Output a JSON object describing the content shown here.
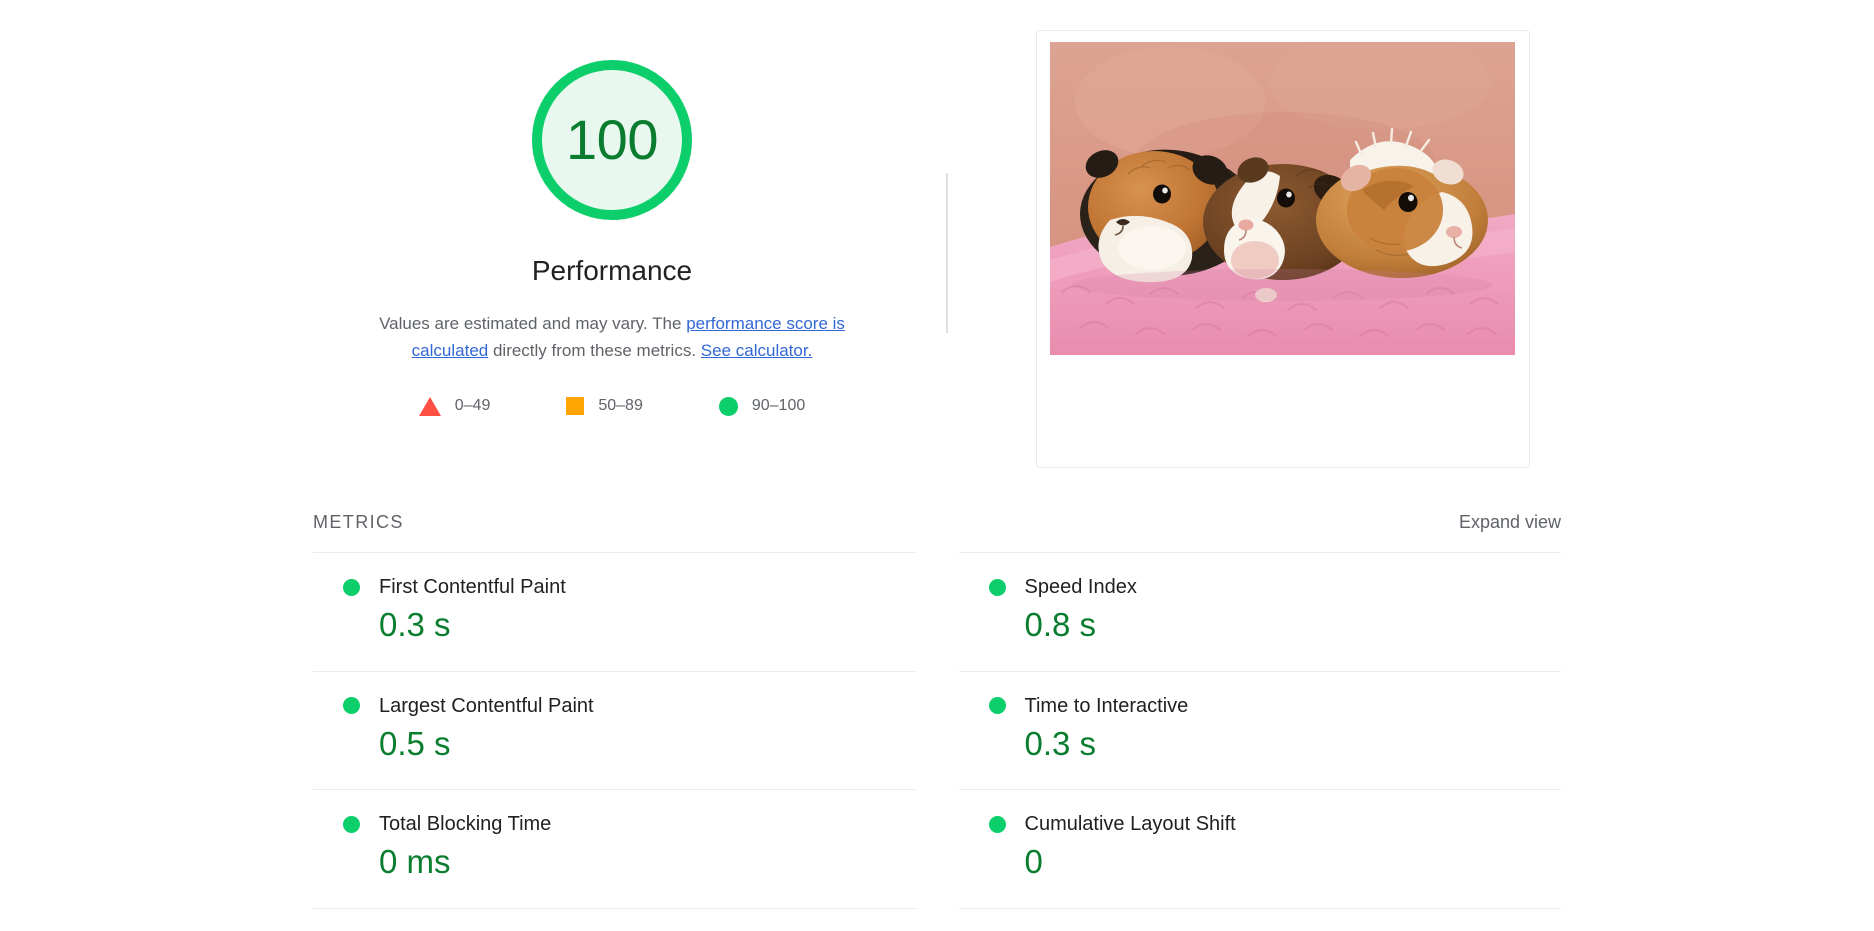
{
  "report": {
    "gauge": {
      "score": "100",
      "category_title": "Performance",
      "description_prefix": "Values are estimated and may vary. The ",
      "link_calculated": "performance score is calculated",
      "description_middle": " directly from these metrics. ",
      "link_see_calculator": "See calculator.",
      "ring_color": "#0cce6b",
      "fill_color": "#e8f8ef",
      "score_color": "#0a7c2f"
    },
    "legend": [
      {
        "icon": "triangle",
        "label": "0–49",
        "color": "#ff4e42"
      },
      {
        "icon": "square",
        "label": "50–89",
        "color": "#ffa400"
      },
      {
        "icon": "circle",
        "label": "90–100",
        "color": "#0cce6b"
      }
    ],
    "thumbnail": {
      "alt": "Final screenshot of the audited page showing three guinea pigs on a pink blanket"
    },
    "metrics": {
      "section_title": "METRICS",
      "expand_view_label": "Expand view",
      "left_column": [
        {
          "label": "First Contentful Paint",
          "value": "0.3 s",
          "rating": "pass"
        },
        {
          "label": "Largest Contentful Paint",
          "value": "0.5 s",
          "rating": "pass"
        },
        {
          "label": "Total Blocking Time",
          "value": "0 ms",
          "rating": "pass"
        }
      ],
      "right_column": [
        {
          "label": "Speed Index",
          "value": "0.8 s",
          "rating": "pass"
        },
        {
          "label": "Time to Interactive",
          "value": "0.3 s",
          "rating": "pass"
        },
        {
          "label": "Cumulative Layout Shift",
          "value": "0",
          "rating": "pass"
        }
      ]
    }
  }
}
